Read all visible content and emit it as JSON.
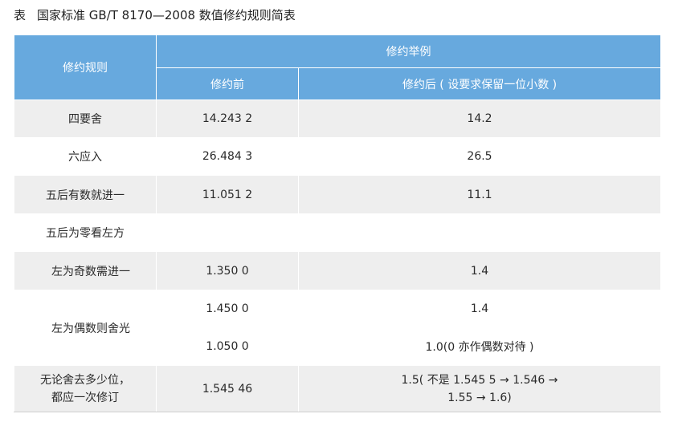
{
  "caption": {
    "label": "表",
    "title": "国家标准 GB/T  8170—2008 数值修约规则简表"
  },
  "table": {
    "headers": {
      "rule": "修约规则",
      "example": "修约举例",
      "before": "修约前",
      "after": "修约后 ( 设要求保留一位小数 )"
    },
    "rows": {
      "r1": {
        "rule": "四要舍",
        "before": "14.243 2",
        "after": "14.2"
      },
      "r2": {
        "rule": "六应入",
        "before": "26.484 3",
        "after": "26.5"
      },
      "r3": {
        "rule": "五后有数就进一",
        "before": "11.051 2",
        "after": "11.1"
      },
      "r4": {
        "rule": "五后为零看左方"
      },
      "r5": {
        "rule": "左为奇数需进一",
        "before": "1.350 0",
        "after": "1.4"
      },
      "r6": {
        "rule": "左为偶数则舍光",
        "before_a": "1.450 0",
        "after_a": "1.4",
        "before_b": "1.050 0",
        "after_b": "1.0(0 亦作偶数对待 )"
      },
      "r7": {
        "rule_line1": "无论舍去多少位，",
        "rule_line2": "都应一次修订",
        "before": "1.545 46",
        "after_line1": "1.5( 不是 1.545 5 → 1.546 →",
        "after_line2": "1.55 → 1.6)"
      }
    }
  }
}
